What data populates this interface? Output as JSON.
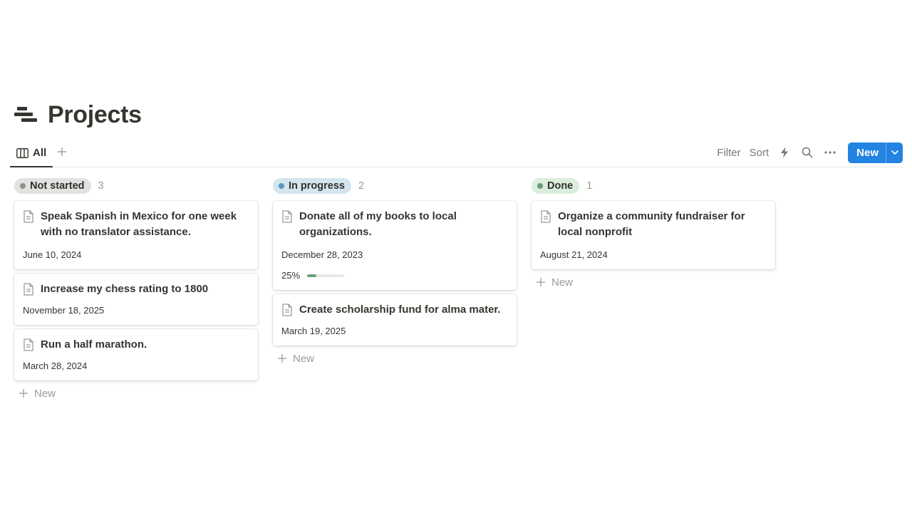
{
  "page": {
    "title": "Projects",
    "icon": "page-stack-icon"
  },
  "viewbar": {
    "tabs": [
      {
        "label": "All",
        "icon": "board-view-icon",
        "active": true
      }
    ],
    "add_view_icon": "plus-icon",
    "filter_label": "Filter",
    "sort_label": "Sort",
    "automation_icon": "lightning-icon",
    "search_icon": "search-icon",
    "more_icon": "more-icon",
    "new_label": "New",
    "new_dropdown_icon": "chevron-down-icon"
  },
  "colors": {
    "accent": "#2383e2",
    "not_started_bg": "#e3e2e0",
    "not_started_dot": "#91918e",
    "in_progress_bg": "#d3e5ef",
    "in_progress_dot": "#5b97bd",
    "done_bg": "#dbeddb",
    "done_dot": "#6c9b7d"
  },
  "board": {
    "columns": [
      {
        "status": "Not started",
        "count": "3",
        "cards": [
          {
            "title": "Speak Spanish in Mexico for one week with no translator assistance.",
            "date": "June 10, 2024"
          },
          {
            "title": "Increase my chess rating to 1800",
            "date": "November 18, 2025"
          },
          {
            "title": "Run a half marathon.",
            "date": "March 28, 2024"
          }
        ],
        "new_label": "New"
      },
      {
        "status": "In progress",
        "count": "2",
        "cards": [
          {
            "title": "Donate all of my books to local organizations.",
            "date": "December 28, 2023",
            "progress_label": "25%",
            "progress": 0.25
          },
          {
            "title": "Create scholarship fund for alma mater.",
            "date": "March 19, 2025"
          }
        ],
        "new_label": "New"
      },
      {
        "status": "Done",
        "count": "1",
        "cards": [
          {
            "title": "Organize a community fundraiser for local nonprofit",
            "date": "August 21, 2024"
          }
        ],
        "new_label": "New"
      }
    ]
  }
}
